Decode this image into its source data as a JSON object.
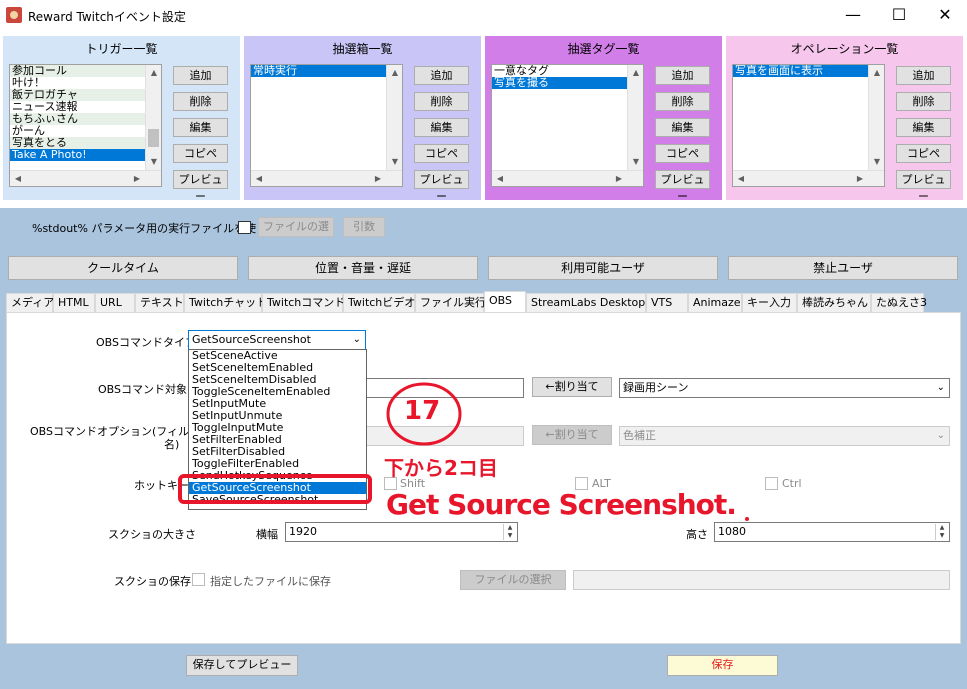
{
  "window": {
    "title": "Reward Twitchイベント設定",
    "controls": {
      "minimize": "—",
      "maximize": "☐",
      "close": "✕"
    }
  },
  "panels": [
    {
      "title": "トリガー一覧",
      "color": "#d3e5f6",
      "items": [
        "参加コール",
        "叶け！",
        "飯テロガチャ",
        "ニュース速報",
        "もちふぃさん",
        "がーん",
        "写真をとる",
        "Take A Photo!"
      ],
      "selected_index": 7,
      "buttons": [
        "追加",
        "削除",
        "編集",
        "コピペ",
        "プレビュー"
      ]
    },
    {
      "title": "抽選箱一覧",
      "color": "#c9c5f6",
      "items": [
        "常時実行"
      ],
      "selected_index": 0,
      "buttons": [
        "追加",
        "削除",
        "編集",
        "コピペ",
        "プレビュー"
      ]
    },
    {
      "title": "抽選タグ一覧",
      "color": "#d17ee8",
      "items": [
        "一意なタグ",
        "写真を撮る"
      ],
      "selected_index": 1,
      "buttons": [
        "追加",
        "削除",
        "編集",
        "コピペ",
        "プレビュー"
      ]
    },
    {
      "title": "オペレーション一覧",
      "color": "#f7c6ec",
      "items": [
        "写真を画面に表示"
      ],
      "selected_index": 0,
      "buttons": [
        "追加",
        "削除",
        "編集",
        "コピペ",
        "プレビュー"
      ]
    }
  ],
  "stdout_row": {
    "label": "%stdout% パラメータ用の実行ファイルを使う",
    "file_button": "ファイルの選",
    "args_button": "引数"
  },
  "big_buttons": [
    "クールタイム",
    "位置・音量・遅延",
    "利用可能ユーザ",
    "禁止ユーザ"
  ],
  "tabs": [
    "メディア",
    "HTML",
    "URL",
    "テキスト",
    "Twitchチャット",
    "Twitchコマンド",
    "Twitchビデオ",
    "ファイル実行",
    "OBS",
    "StreamLabs Desktop",
    "VTS",
    "Animaze",
    "キー入力",
    "棒読みちゃん",
    "たぬえさ3"
  ],
  "active_tab": "OBS",
  "obs": {
    "command_type_label": "OBSコマンドタイプ",
    "command_type_value": "GetSourceScreenshot",
    "dropdown_items": [
      "SetSceneActive",
      "SetSceneItemEnabled",
      "SetSceneItemDisabled",
      "ToggleSceneItemEnabled",
      "SetInputMute",
      "SetInputUnmute",
      "ToggleInputMute",
      "SetFilterEnabled",
      "SetFilterDisabled",
      "ToggleFilterEnabled",
      "SendHotkeySequence",
      "GetSourceScreenshot",
      "SaveSourceScreenshot"
    ],
    "dropdown_selected": 11,
    "target_label": "OBSコマンド対象",
    "assign_button": "←割り当て",
    "scene_value": "録画用シーン",
    "option_label_1": "OBSコマンドオプション(フィルター",
    "option_label_2": "名)",
    "option_assign_button": "←割り当て",
    "option_value": "色補正",
    "hotkey_label": "ホットキー",
    "shift_label": "Shift",
    "alt_label": "ALT",
    "ctrl_label": "Ctrl",
    "size_label": "スクショの大きさ",
    "width_label": "横幅",
    "width_value": "1920",
    "height_label": "高さ",
    "height_value": "1080",
    "save_label": "スクショの保存",
    "save_checkbox_label": "指定したファイルに保存",
    "file_select_button": "ファイルの選択"
  },
  "bottom": {
    "save_preview_button": "保存してプレビュー",
    "save_button": "保存"
  },
  "annotations": {
    "circle_number": "17",
    "note_line1": "下から2コ目",
    "note_line2": "Get Source Screenshot."
  }
}
